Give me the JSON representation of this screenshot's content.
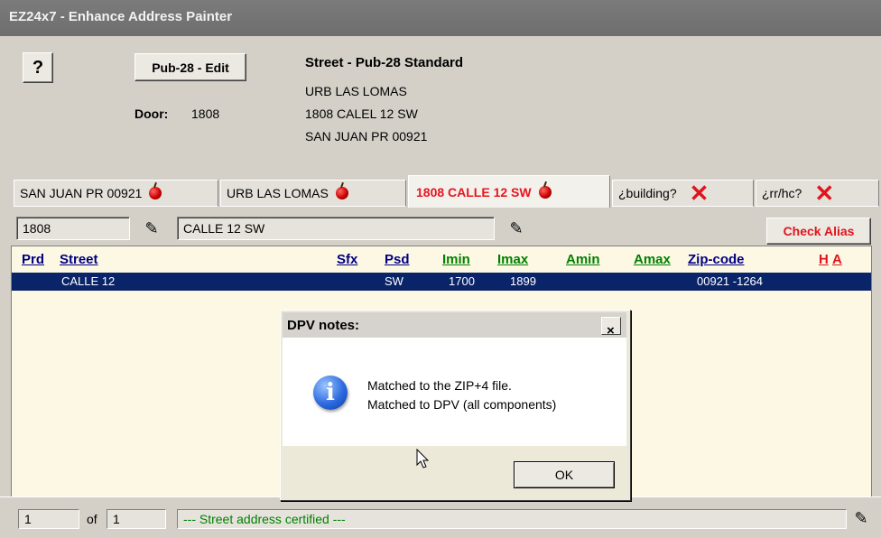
{
  "window": {
    "title": "EZ24x7 - Enhance Address Painter"
  },
  "header": {
    "help_icon": "question-mark-icon",
    "pub_button_label": "Pub-28 - Edit",
    "door_label": "Door:",
    "door_value": "1808",
    "standard_title": "Street - Pub-28 Standard",
    "address_lines": [
      "URB LAS LOMAS",
      "1808  CALEL 12  SW",
      "SAN JUAN PR 00921"
    ]
  },
  "tabs": [
    {
      "label": "SAN JUAN PR 00921",
      "icon": "apple-icon",
      "active": false
    },
    {
      "label": "URB LAS LOMAS",
      "icon": "apple-icon",
      "active": false
    },
    {
      "label": "1808 CALLE 12 SW",
      "icon": "apple-icon",
      "active": true
    },
    {
      "label": "¿building?",
      "icon": "red-x-icon",
      "active": false
    },
    {
      "label": "¿rr/hc?",
      "icon": "red-x-icon",
      "active": false
    }
  ],
  "inputs": {
    "number_value": "1808",
    "street_value": "CALLE 12 SW",
    "check_alias_label": "Check Alias"
  },
  "grid": {
    "headers": [
      {
        "label": "Prd",
        "color": "#000080"
      },
      {
        "label": "Street",
        "color": "#000080"
      },
      {
        "label": "Sfx",
        "color": "#000080"
      },
      {
        "label": "Psd",
        "color": "#000080"
      },
      {
        "label": "Imin",
        "color": "#008000"
      },
      {
        "label": "Imax",
        "color": "#008000"
      },
      {
        "label": "Amin",
        "color": "#008000"
      },
      {
        "label": "Amax",
        "color": "#008000"
      },
      {
        "label": "Zip-code",
        "color": "#000080"
      },
      {
        "label": "H",
        "color": "#e0141e"
      },
      {
        "label": "A",
        "color": "#e0141e"
      }
    ],
    "rows": [
      {
        "street": "CALLE 12",
        "psd": "SW",
        "imin": "1700",
        "imax": "1899",
        "zip": "00921 -1264"
      }
    ]
  },
  "status": {
    "page_value": "1",
    "of_label": "of",
    "total_value": "1",
    "message": "--- Street address certified ---",
    "message_color": "#008000"
  },
  "dialog": {
    "title": "DPV notes:",
    "close_label": "×",
    "line1": "Matched to the ZIP+4 file.",
    "line2": "Matched to DPV (all components)",
    "ok_label": "OK",
    "icon": "info-icon"
  }
}
